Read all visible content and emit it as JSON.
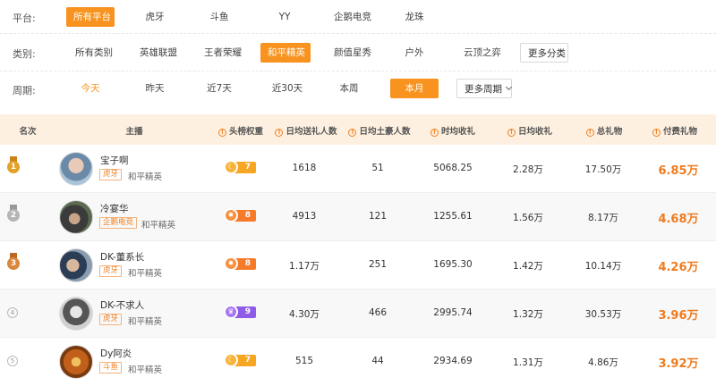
{
  "filters": {
    "platform": {
      "label": "平台:",
      "options": [
        "所有平台",
        "虎牙",
        "斗鱼",
        "YY",
        "企鹅电竞",
        "龙珠"
      ]
    },
    "category": {
      "label": "类别:",
      "options": [
        "所有类别",
        "英雄联盟",
        "王者荣耀",
        "和平精英",
        "颜值星秀",
        "户外",
        "云顶之弈"
      ],
      "more": "更多分类"
    },
    "period": {
      "label": "周期:",
      "options": [
        "今天",
        "昨天",
        "近7天",
        "近30天",
        "本周",
        "本月"
      ],
      "more": "更多周期"
    }
  },
  "table": {
    "headers": {
      "rank": "名次",
      "streamer": "主播",
      "head_weight": "头榜权重",
      "daily_gift_senders": "日均送礼人数",
      "daily_tycoons": "日均土豪人数",
      "hourly_income": "时均收礼",
      "daily_income": "日均收礼",
      "total_gifts": "总礼物",
      "paid_gifts": "付费礼物"
    },
    "rows": [
      {
        "rank": "1",
        "name": "宝子啊",
        "platform": "虎牙",
        "category": "和平精英",
        "weight": "7",
        "senders": "1618",
        "tycoons": "51",
        "hourly": "5068.25",
        "daily": "2.28万",
        "total": "17.50万",
        "paid": "6.85万"
      },
      {
        "rank": "2",
        "name": "冷宴华",
        "platform": "企鹅电竞",
        "category": "和平精英",
        "weight": "8",
        "senders": "4913",
        "tycoons": "121",
        "hourly": "1255.61",
        "daily": "1.56万",
        "total": "8.17万",
        "paid": "4.68万"
      },
      {
        "rank": "3",
        "name": "DK-董系长",
        "platform": "虎牙",
        "category": "和平精英",
        "weight": "8",
        "senders": "1.17万",
        "tycoons": "251",
        "hourly": "1695.30",
        "daily": "1.42万",
        "total": "10.14万",
        "paid": "4.26万"
      },
      {
        "rank": "4",
        "name": "DK-不求人",
        "platform": "虎牙",
        "category": "和平精英",
        "weight": "9",
        "senders": "4.30万",
        "tycoons": "466",
        "hourly": "2995.74",
        "daily": "1.32万",
        "total": "30.53万",
        "paid": "3.96万"
      },
      {
        "rank": "5",
        "name": "Dy阿炎",
        "platform": "斗鱼",
        "category": "和平精英",
        "weight": "7",
        "senders": "515",
        "tycoons": "44",
        "hourly": "2934.69",
        "daily": "1.31万",
        "total": "4.86万",
        "paid": "3.92万"
      }
    ]
  },
  "colors": {
    "accent": "#f7931e",
    "paid_text": "#f07b1d",
    "header_bg": "#fdf0e0"
  }
}
